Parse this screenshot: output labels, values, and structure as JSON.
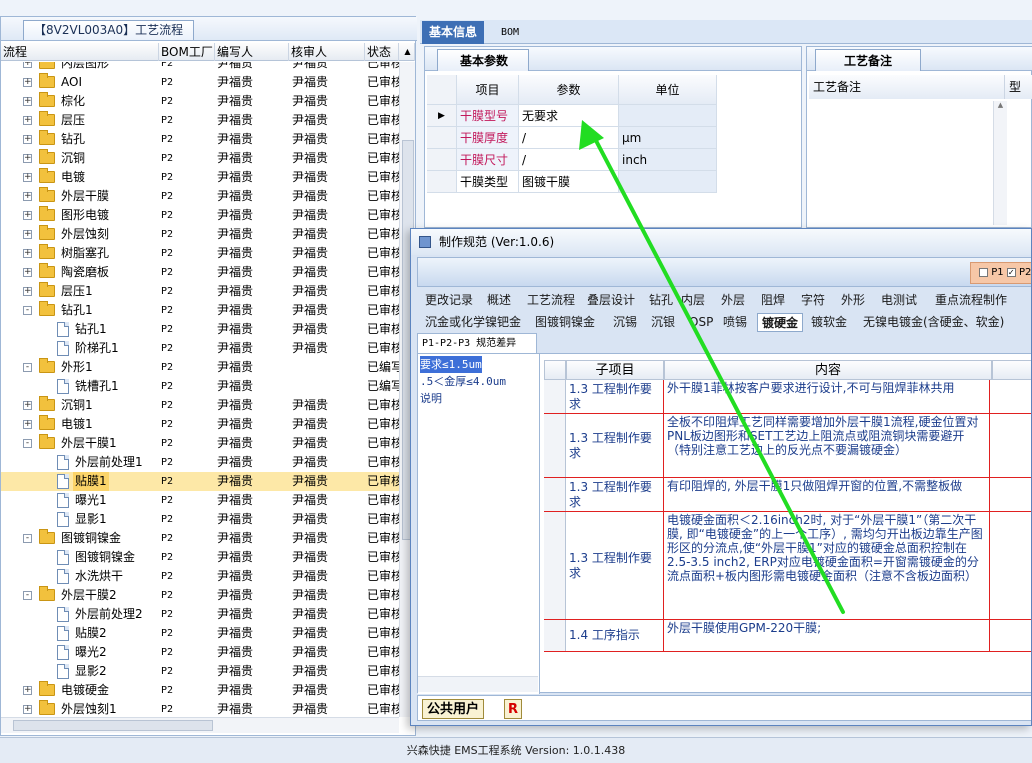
{
  "left_panel": {
    "tab_title": "【8V2VL003A0】工艺流程",
    "columns": [
      "流程",
      "BOM工厂",
      "编写人",
      "核审人",
      "状态"
    ],
    "rows": [
      {
        "level": 1,
        "type": "folder",
        "expand": "+",
        "name": "内层图形",
        "bom": "P2",
        "writer": "尹福贵",
        "reviewer": "尹福贵",
        "status": "已审核"
      },
      {
        "level": 1,
        "type": "folder",
        "expand": "+",
        "name": "AOI",
        "bom": "P2",
        "writer": "尹福贵",
        "reviewer": "尹福贵",
        "status": "已审核"
      },
      {
        "level": 1,
        "type": "folder",
        "expand": "+",
        "name": "棕化",
        "bom": "P2",
        "writer": "尹福贵",
        "reviewer": "尹福贵",
        "status": "已审核"
      },
      {
        "level": 1,
        "type": "folder",
        "expand": "+",
        "name": "层压",
        "bom": "P2",
        "writer": "尹福贵",
        "reviewer": "尹福贵",
        "status": "已审核"
      },
      {
        "level": 1,
        "type": "folder",
        "expand": "+",
        "name": "钻孔",
        "bom": "P2",
        "writer": "尹福贵",
        "reviewer": "尹福贵",
        "status": "已审核"
      },
      {
        "level": 1,
        "type": "folder",
        "expand": "+",
        "name": "沉铜",
        "bom": "P2",
        "writer": "尹福贵",
        "reviewer": "尹福贵",
        "status": "已审核"
      },
      {
        "level": 1,
        "type": "folder",
        "expand": "+",
        "name": "电镀",
        "bom": "P2",
        "writer": "尹福贵",
        "reviewer": "尹福贵",
        "status": "已审核"
      },
      {
        "level": 1,
        "type": "folder",
        "expand": "+",
        "name": "外层干膜",
        "bom": "P2",
        "writer": "尹福贵",
        "reviewer": "尹福贵",
        "status": "已审核"
      },
      {
        "level": 1,
        "type": "folder",
        "expand": "+",
        "name": "图形电镀",
        "bom": "P2",
        "writer": "尹福贵",
        "reviewer": "尹福贵",
        "status": "已审核"
      },
      {
        "level": 1,
        "type": "folder",
        "expand": "+",
        "name": "外层蚀刻",
        "bom": "P2",
        "writer": "尹福贵",
        "reviewer": "尹福贵",
        "status": "已审核"
      },
      {
        "level": 1,
        "type": "folder",
        "expand": "+",
        "name": "树脂塞孔",
        "bom": "P2",
        "writer": "尹福贵",
        "reviewer": "尹福贵",
        "status": "已审核"
      },
      {
        "level": 1,
        "type": "folder",
        "expand": "+",
        "name": "陶瓷磨板",
        "bom": "P2",
        "writer": "尹福贵",
        "reviewer": "尹福贵",
        "status": "已审核"
      },
      {
        "level": 1,
        "type": "folder",
        "expand": "+",
        "name": "层压1",
        "bom": "P2",
        "writer": "尹福贵",
        "reviewer": "尹福贵",
        "status": "已审核"
      },
      {
        "level": 1,
        "type": "folder",
        "expand": "-",
        "name": "钻孔1",
        "bom": "P2",
        "writer": "尹福贵",
        "reviewer": "尹福贵",
        "status": "已审核"
      },
      {
        "level": 2,
        "type": "doc",
        "expand": "",
        "name": "钻孔1",
        "bom": "P2",
        "writer": "尹福贵",
        "reviewer": "尹福贵",
        "status": "已审核"
      },
      {
        "level": 2,
        "type": "doc",
        "expand": "",
        "name": "阶梯孔1",
        "bom": "P2",
        "writer": "尹福贵",
        "reviewer": "尹福贵",
        "status": "已审核"
      },
      {
        "level": 1,
        "type": "folder",
        "expand": "-",
        "name": "外形1",
        "bom": "P2",
        "writer": "尹福贵",
        "reviewer": "",
        "status": "已编写"
      },
      {
        "level": 2,
        "type": "doc",
        "expand": "",
        "name": "铣槽孔1",
        "bom": "P2",
        "writer": "尹福贵",
        "reviewer": "",
        "status": "已编写"
      },
      {
        "level": 1,
        "type": "folder",
        "expand": "+",
        "name": "沉铜1",
        "bom": "P2",
        "writer": "尹福贵",
        "reviewer": "尹福贵",
        "status": "已审核"
      },
      {
        "level": 1,
        "type": "folder",
        "expand": "+",
        "name": "电镀1",
        "bom": "P2",
        "writer": "尹福贵",
        "reviewer": "尹福贵",
        "status": "已审核"
      },
      {
        "level": 1,
        "type": "folder",
        "expand": "-",
        "name": "外层干膜1",
        "bom": "P2",
        "writer": "尹福贵",
        "reviewer": "尹福贵",
        "status": "已审核"
      },
      {
        "level": 2,
        "type": "doc",
        "expand": "",
        "name": "外层前处理1",
        "bom": "P2",
        "writer": "尹福贵",
        "reviewer": "尹福贵",
        "status": "已审核"
      },
      {
        "level": 2,
        "type": "doc",
        "expand": "",
        "name": "贴膜1",
        "bom": "P2",
        "writer": "尹福贵",
        "reviewer": "尹福贵",
        "status": "已审核",
        "selected": true
      },
      {
        "level": 2,
        "type": "doc",
        "expand": "",
        "name": "曝光1",
        "bom": "P2",
        "writer": "尹福贵",
        "reviewer": "尹福贵",
        "status": "已审核"
      },
      {
        "level": 2,
        "type": "doc",
        "expand": "",
        "name": "显影1",
        "bom": "P2",
        "writer": "尹福贵",
        "reviewer": "尹福贵",
        "status": "已审核"
      },
      {
        "level": 1,
        "type": "folder",
        "expand": "-",
        "name": "图镀铜镍金",
        "bom": "P2",
        "writer": "尹福贵",
        "reviewer": "尹福贵",
        "status": "已审核"
      },
      {
        "level": 2,
        "type": "doc",
        "expand": "",
        "name": "图镀铜镍金",
        "bom": "P2",
        "writer": "尹福贵",
        "reviewer": "尹福贵",
        "status": "已审核"
      },
      {
        "level": 2,
        "type": "doc",
        "expand": "",
        "name": "水洗烘干",
        "bom": "P2",
        "writer": "尹福贵",
        "reviewer": "尹福贵",
        "status": "已审核"
      },
      {
        "level": 1,
        "type": "folder",
        "expand": "-",
        "name": "外层干膜2",
        "bom": "P2",
        "writer": "尹福贵",
        "reviewer": "尹福贵",
        "status": "已审核"
      },
      {
        "level": 2,
        "type": "doc",
        "expand": "",
        "name": "外层前处理2",
        "bom": "P2",
        "writer": "尹福贵",
        "reviewer": "尹福贵",
        "status": "已审核"
      },
      {
        "level": 2,
        "type": "doc",
        "expand": "",
        "name": "贴膜2",
        "bom": "P2",
        "writer": "尹福贵",
        "reviewer": "尹福贵",
        "status": "已审核"
      },
      {
        "level": 2,
        "type": "doc",
        "expand": "",
        "name": "曝光2",
        "bom": "P2",
        "writer": "尹福贵",
        "reviewer": "尹福贵",
        "status": "已审核"
      },
      {
        "level": 2,
        "type": "doc",
        "expand": "",
        "name": "显影2",
        "bom": "P2",
        "writer": "尹福贵",
        "reviewer": "尹福贵",
        "status": "已审核"
      },
      {
        "level": 1,
        "type": "folder",
        "expand": "+",
        "name": "电镀硬金",
        "bom": "P2",
        "writer": "尹福贵",
        "reviewer": "尹福贵",
        "status": "已审核"
      },
      {
        "level": 1,
        "type": "folder",
        "expand": "+",
        "name": "外层蚀刻1",
        "bom": "P2",
        "writer": "尹福贵",
        "reviewer": "尹福贵",
        "status": "已审核"
      }
    ]
  },
  "top_right": {
    "tabs": [
      "基本信息",
      "BOM"
    ],
    "params_title": "基本参数",
    "params_headers": [
      "项目",
      "参数",
      "单位"
    ],
    "params_rows": [
      {
        "key": "干膜型号",
        "value": "无要求",
        "unit": "",
        "pink": true,
        "current": true
      },
      {
        "key": "干膜厚度",
        "value": "/",
        "unit": "μm",
        "pink": true
      },
      {
        "key": "干膜尺寸",
        "value": "/",
        "unit": "inch",
        "pink": true
      },
      {
        "key": "干膜类型",
        "value": "图镀干膜",
        "unit": "",
        "pink": false
      }
    ],
    "notes_title": "工艺备注",
    "notes_headers": [
      "工艺备注",
      "型号"
    ]
  },
  "dialog": {
    "title": "制作规范 (Ver:1.0.6)",
    "checkbox_labels": [
      "P1",
      "P2"
    ],
    "tab_row1": [
      "更改记录",
      "概述",
      "工艺流程",
      "叠层设计",
      "钻孔",
      "内层",
      "外层",
      "阻焊",
      "字符",
      "外形",
      "电测试",
      "重点流程制作"
    ],
    "tab_row2": [
      "沉金或化学镍钯金",
      "图镀铜镍金",
      "沉锡",
      "沉银",
      "OSP",
      "喷锡",
      "镀硬金",
      "镀软金",
      "无镍电镀金(含硬金、软金)"
    ],
    "active_tab": "镀硬金",
    "sub_tab": "P1-P2-P3 规范差异",
    "left_list": [
      "要求≤1.5um",
      ".5＜金厚≤4.0um",
      "说明"
    ],
    "grid_headers": [
      "子项目",
      "内容"
    ],
    "grid_rows": [
      {
        "sub": "1.3 工程制作要求",
        "content": "外干膜1菲林按客户要求进行设计,不可与阻焊菲林共用"
      },
      {
        "sub": "1.3 工程制作要求",
        "content": "全板不印阻焊工艺同样需要增加外层干膜1流程,硬金位置对PNL板边图形和SET工艺边上阻流点或阻流铜块需要避开（特别注意工艺边上的反光点不要漏镀硬金）"
      },
      {
        "sub": "1.3 工程制作要求",
        "content": "有印阻焊的, 外层干膜1只做阻焊开窗的位置,不需整板做"
      },
      {
        "sub": "1.3 工程制作要求",
        "content": "电镀硬金面积＜2.16inch2时, 对于“外层干膜1”（第二次干膜, 即“电镀硬金”的上一个工序）, 需均匀开出板边靠生产图形区的分流点,使“外层干膜1”对应的镀硬金总面积控制在2.5-3.5 inch2, ERP对应电镀硬金面积=开窗需镀硬金的分流点面积+板内图形需电镀硬金面积（注意不含板边面积）"
      },
      {
        "sub": "1.4 工序指示",
        "content": "外层干膜使用GPM-220干膜;"
      }
    ],
    "user_label": "公共用户",
    "r_label": "R"
  },
  "status_bar": "兴森快捷 EMS工程系统 Version: 1.0.1.438",
  "colors": {
    "accent": "#3d6fb5",
    "selected_row": "#fde8a7",
    "grid_border_red": "#e02020",
    "arrow_green": "#22dd22",
    "pink_key": "#c2185b"
  }
}
